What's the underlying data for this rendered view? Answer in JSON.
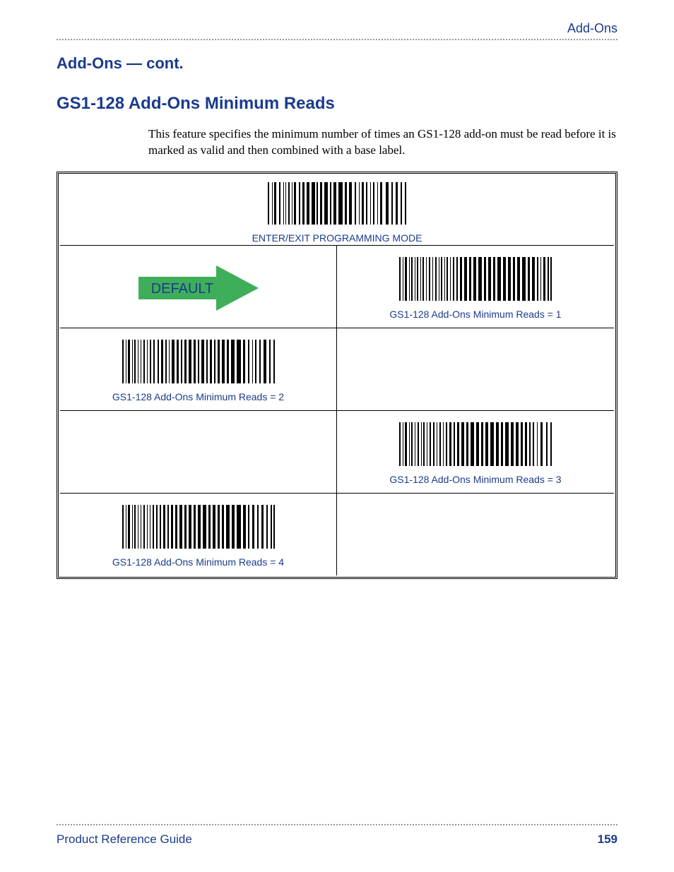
{
  "header": {
    "right": "Add-Ons"
  },
  "headings": {
    "h1": "Add-Ons — cont.",
    "h2": "GS1-128 Add-Ons Minimum Reads"
  },
  "body": {
    "paragraph": "This feature specifies the minimum number of times an GS1-128 add-on must be read before it is marked as valid and then combined with a base label."
  },
  "topbarcode": {
    "caption": "ENTER/EXIT PROGRAMMING MODE"
  },
  "default_arrow": {
    "label": "DEFAULT"
  },
  "options": {
    "r1": {
      "caption": "GS1-128 Add-Ons Minimum Reads = 1"
    },
    "r2": {
      "caption": "GS1-128 Add-Ons Minimum Reads = 2"
    },
    "r3": {
      "caption": "GS1-128 Add-Ons Minimum Reads = 3"
    },
    "r4": {
      "caption": "GS1-128 Add-Ons Minimum Reads = 4"
    }
  },
  "footer": {
    "left": "Product Reference Guide",
    "page": "159"
  }
}
